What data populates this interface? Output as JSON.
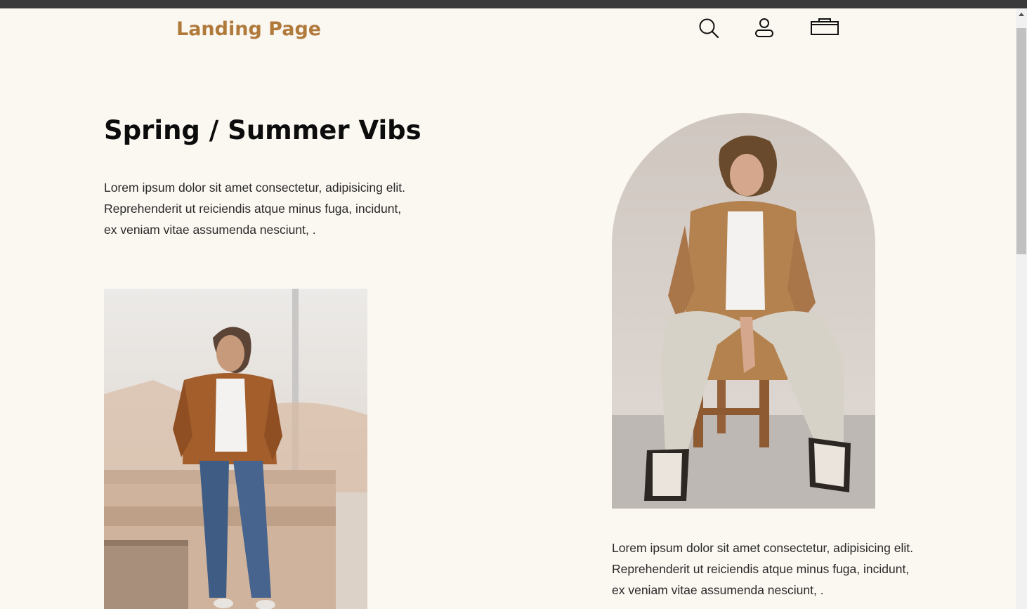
{
  "header": {
    "logo": "Landing Page",
    "icons": [
      "search-icon",
      "user-icon",
      "cart-icon"
    ]
  },
  "hero": {
    "title": "Spring / Summer Vibs",
    "paragraph": "Lorem ipsum dolor sit amet consectetur, adipisicing elit. Reprehenderit ut reiciendis atque minus fuga, incidunt, ex veniam vitae assumenda nesciunt, ."
  },
  "feature": {
    "paragraph": "Lorem ipsum dolor sit amet consectetur, adipisicing elit. Reprehenderit ut reiciendis atque minus fuga, incidunt, ex veniam vitae assumenda nesciunt, ."
  },
  "colors": {
    "background": "#fbf7f1",
    "brand": "#b07a3b",
    "heading": "#0c0c0c",
    "body_text": "#2a2a2a"
  }
}
